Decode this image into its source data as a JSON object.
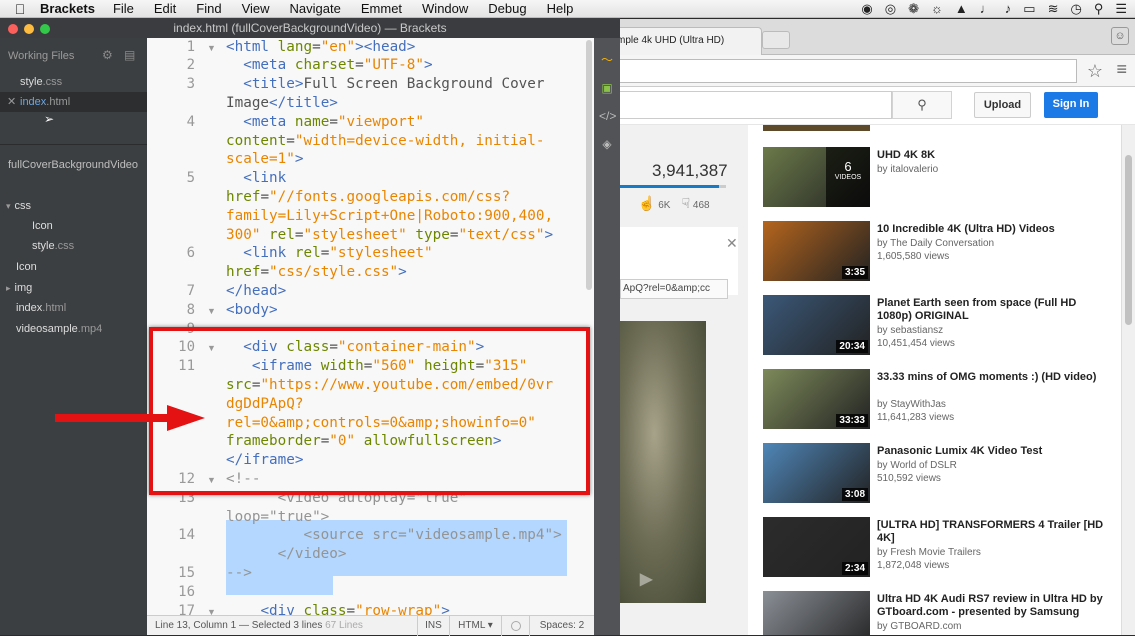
{
  "menubar": {
    "app_name": "Brackets",
    "menus": [
      "File",
      "Edit",
      "Find",
      "View",
      "Navigate",
      "Emmet",
      "Window",
      "Debug",
      "Help"
    ]
  },
  "window": {
    "title": "index.html (fullCoverBackgroundVideo) — Brackets"
  },
  "sidebar": {
    "working_files_label": "Working Files",
    "working_files": [
      {
        "name": "style",
        "ext": ".css"
      },
      {
        "name": "index",
        "ext": ".html"
      }
    ],
    "project_title": "fullCoverBackgroundVideo",
    "tree": [
      {
        "label": "css",
        "type": "folder",
        "depth": 0,
        "expanded": true
      },
      {
        "label": "Icon",
        "type": "file",
        "depth": 1
      },
      {
        "label": "style",
        "ext": ".css",
        "type": "file",
        "depth": 1
      },
      {
        "label": "Icon",
        "type": "file",
        "depth": 0
      },
      {
        "label": "img",
        "type": "folder",
        "depth": 0,
        "expanded": false
      },
      {
        "label": "index",
        "ext": ".html",
        "type": "file",
        "depth": 0
      },
      {
        "label": "videosample",
        "ext": ".mp4",
        "type": "file",
        "depth": 0
      }
    ]
  },
  "editor": {
    "line_numbers": [
      "1",
      "2",
      "3",
      "4",
      "5",
      "6",
      "7",
      "8",
      "9",
      "10",
      "11",
      "12",
      "13",
      "14",
      "15",
      "16",
      "17"
    ],
    "lines": {
      "l1": [
        [
          "tag",
          "<html "
        ],
        [
          "attr",
          "lang"
        ],
        [
          "txt",
          "="
        ],
        [
          "val",
          "\"en\""
        ],
        [
          "tag",
          "><head>"
        ]
      ],
      "l2": [
        [
          "txt",
          "  "
        ],
        [
          "tag",
          "<meta "
        ],
        [
          "attr",
          "charset"
        ],
        [
          "txt",
          "="
        ],
        [
          "val",
          "\"UTF-8\""
        ],
        [
          "tag",
          ">"
        ]
      ],
      "l3a": [
        [
          "txt",
          "  "
        ],
        [
          "tag",
          "<title>"
        ],
        [
          "txt",
          "Full Screen Background Cover"
        ]
      ],
      "l3b": [
        [
          "txt",
          "Image"
        ],
        [
          "tag",
          "</title>"
        ]
      ],
      "l4a": [
        [
          "txt",
          "  "
        ],
        [
          "tag",
          "<meta "
        ],
        [
          "attr",
          "name"
        ],
        [
          "txt",
          "="
        ],
        [
          "val",
          "\"viewport\""
        ]
      ],
      "l4b": [
        [
          "attr",
          "content"
        ],
        [
          "txt",
          "="
        ],
        [
          "val",
          "\"width=device-width, initial-"
        ]
      ],
      "l4c": [
        [
          "val",
          "scale=1\""
        ],
        [
          "tag",
          ">"
        ]
      ],
      "l5a": [
        [
          "txt",
          "  "
        ],
        [
          "tag",
          "<link"
        ]
      ],
      "l5b": [
        [
          "attr",
          "href"
        ],
        [
          "txt",
          "="
        ],
        [
          "val",
          "\"//fonts.googleapis.com/css?"
        ]
      ],
      "l5c": [
        [
          "val",
          "family=Lily+Script+One|Roboto:900,400,"
        ]
      ],
      "l5d": [
        [
          "val",
          "300\" "
        ],
        [
          "attr",
          "rel"
        ],
        [
          "txt",
          "="
        ],
        [
          "val",
          "\"stylesheet\" "
        ],
        [
          "attr",
          "type"
        ],
        [
          "txt",
          "="
        ],
        [
          "val",
          "\"text/css\""
        ],
        [
          "tag",
          ">"
        ]
      ],
      "l6a": [
        [
          "txt",
          "  "
        ],
        [
          "tag",
          "<link "
        ],
        [
          "attr",
          "rel"
        ],
        [
          "txt",
          "="
        ],
        [
          "val",
          "\"stylesheet\""
        ]
      ],
      "l6b": [
        [
          "attr",
          "href"
        ],
        [
          "txt",
          "="
        ],
        [
          "val",
          "\"css/style.css\""
        ],
        [
          "tag",
          ">"
        ]
      ],
      "l7": [
        [
          "tag",
          "</head>"
        ]
      ],
      "l8": [
        [
          "tag",
          "<body>"
        ]
      ],
      "l10": [
        [
          "txt",
          "  "
        ],
        [
          "tag",
          "<div "
        ],
        [
          "attr",
          "class"
        ],
        [
          "txt",
          "="
        ],
        [
          "val",
          "\"container-main\""
        ],
        [
          "tag",
          ">"
        ]
      ],
      "l11a": [
        [
          "txt",
          "   "
        ],
        [
          "tag",
          "<iframe "
        ],
        [
          "attr",
          "width"
        ],
        [
          "txt",
          "="
        ],
        [
          "val",
          "\"560\" "
        ],
        [
          "attr",
          "height"
        ],
        [
          "txt",
          "="
        ],
        [
          "val",
          "\"315\""
        ]
      ],
      "l11b": [
        [
          "attr",
          "src"
        ],
        [
          "txt",
          "="
        ],
        [
          "val",
          "\"https://www.youtube.com/embed/0vr"
        ]
      ],
      "l11c": [
        [
          "val",
          "dgDdPApQ?"
        ]
      ],
      "l11d": [
        [
          "val",
          "rel=0&amp;controls=0&amp;showinfo=0\""
        ]
      ],
      "l11e": [
        [
          "attr",
          "frameborder"
        ],
        [
          "txt",
          "="
        ],
        [
          "val",
          "\"0\" "
        ],
        [
          "attr",
          "allowfullscreen"
        ],
        [
          "tag",
          ">"
        ]
      ],
      "l11f": [
        [
          "tag",
          "</iframe>"
        ]
      ],
      "l12": [
        [
          "cmt",
          "<!--"
        ]
      ],
      "l13a": [
        [
          "cmt",
          "      <video autoplay=\"true\""
        ]
      ],
      "l13b": [
        [
          "cmt",
          "loop=\"true\">"
        ]
      ],
      "l14": [
        [
          "cmt",
          "         <source src=\"videosample.mp4\">"
        ]
      ],
      "l14b": [
        [
          "cmt",
          "      </video>"
        ]
      ],
      "l15": [
        [
          "cmt",
          "-->"
        ]
      ],
      "l17": [
        [
          "txt",
          "    "
        ],
        [
          "tag",
          "<div "
        ],
        [
          "attr",
          "class"
        ],
        [
          "txt",
          "="
        ],
        [
          "val",
          "\"row-wrap\""
        ],
        [
          "tag",
          ">"
        ]
      ]
    }
  },
  "statusbar": {
    "position": "Line 13, Column 1 — Selected 3 lines",
    "lines": "67 Lines",
    "mode": "INS",
    "language": "HTML",
    "spaces": "Spaces: 2"
  },
  "browser": {
    "tab_title": "mple 4k UHD (Ultra HD)",
    "upload": "Upload",
    "signin": "Sign In",
    "view_count": "3,941,387",
    "view_ratio": 0.93,
    "likes": "6K",
    "dislikes": "468",
    "embed_text": "ApQ?rel=0&amp;cc",
    "recommendations": [
      {
        "title": "UHD 4K 8K",
        "channel": "by italovalerio",
        "views": "",
        "duration": "",
        "playlist_count": "6",
        "playlist_label": "VIDEOS",
        "thumb": "#6b7a4a"
      },
      {
        "title": "10 Incredible 4K (Ultra HD) Videos",
        "channel": "by The Daily Conversation",
        "views": "1,605,580 views",
        "duration": "3:35",
        "thumb": "#b5651d"
      },
      {
        "title": "Planet Earth seen from space (Full HD 1080p) ORIGINAL",
        "channel": "by sebastiansz",
        "views": "10,451,454 views",
        "duration": "20:34",
        "thumb": "#3b5878"
      },
      {
        "title": "33.33 mins of OMG moments :) (HD video)",
        "channel": "by StayWithJas",
        "views": "11,641,283 views",
        "duration": "33:33",
        "thumb": "#7d8a5a"
      },
      {
        "title": "Panasonic Lumix 4K Video Test",
        "channel": "by World of DSLR",
        "views": "510,592 views",
        "duration": "3:08",
        "thumb": "#4f86b8"
      },
      {
        "title": "[ULTRA HD] TRANSFORMERS 4 Trailer [HD 4K]",
        "channel": "by Fresh Movie Trailers",
        "views": "1,872,048 views",
        "duration": "2:34",
        "thumb": "#2c2c2c"
      },
      {
        "title": "Ultra HD 4K Audi RS7 review in Ultra HD by GTboard.com - presented by Samsung",
        "channel": "by GTBOARD.com",
        "views": "",
        "duration": "",
        "thumb": "#8a8f96"
      }
    ]
  },
  "colors": {
    "annotation_red": "#e41212",
    "selection": "#b3d7ff",
    "tag": "#446fbd",
    "attribute": "#6d8600",
    "value": "#e88501"
  }
}
